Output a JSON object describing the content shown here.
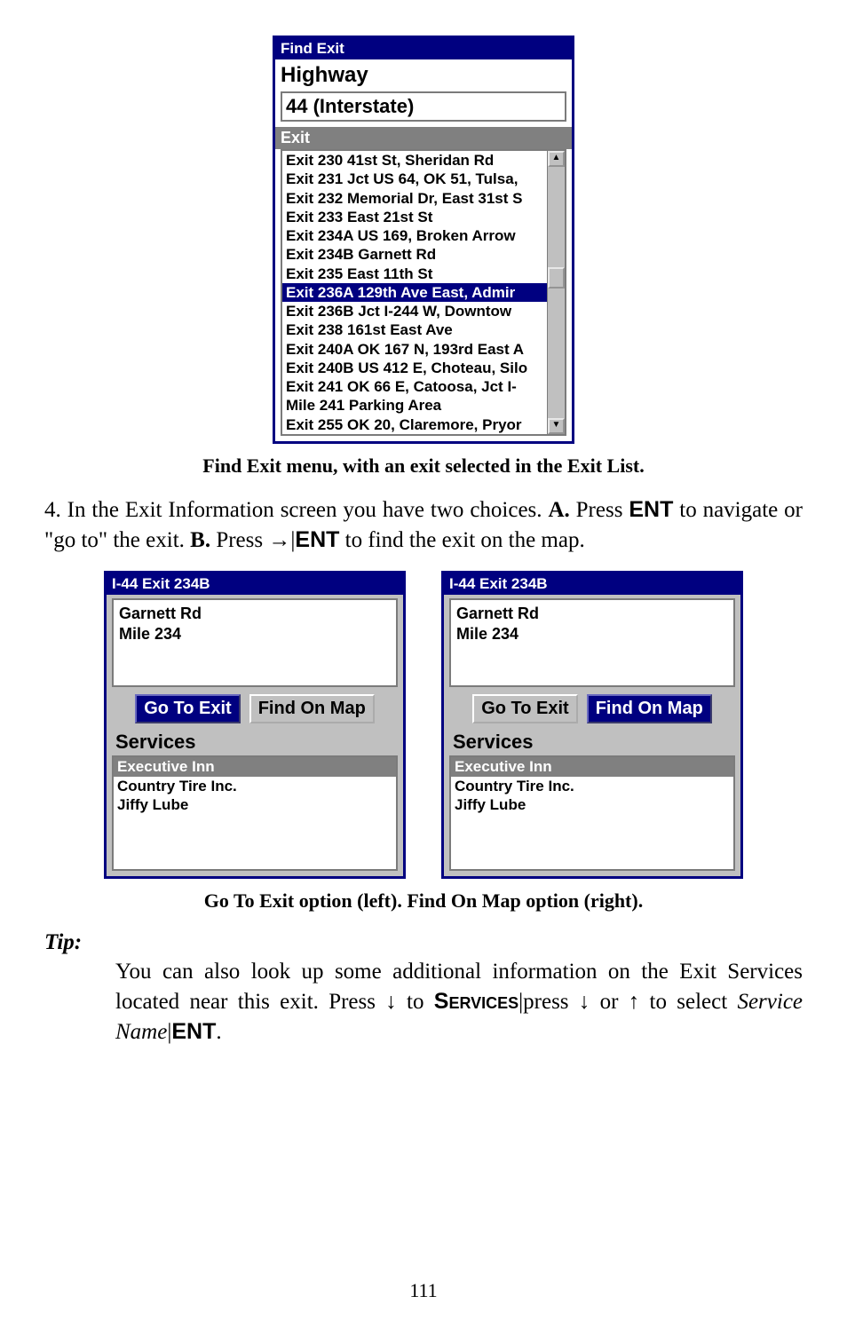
{
  "findExit": {
    "title": "Find Exit",
    "highwayLabel": "Highway",
    "highwayValue": "44 (Interstate)",
    "exitSection": "Exit",
    "exits": [
      "Exit 230 41st St, Sheridan Rd",
      "Exit 231 Jct US 64, OK 51, Tulsa,",
      "Exit 232 Memorial Dr, East 31st S",
      "Exit 233 East 21st St",
      "Exit 234A US 169, Broken Arrow",
      "Exit 234B Garnett Rd",
      "Exit 235 East 11th St",
      "Exit 236A 129th Ave East, Admir",
      "Exit 236B Jct I-244 W, Downtow",
      "Exit 238 161st East Ave",
      "Exit 240A OK 167 N, 193rd East A",
      "Exit 240B US 412 E, Choteau, Silo",
      "Exit 241 OK 66 E, Catoosa, Jct I-",
      "Mile 241 Parking Area",
      "Exit 255 OK 20, Claremore, Pryor"
    ],
    "selectedIndex": 7
  },
  "caption1": "Find Exit menu, with an exit selected in the Exit List.",
  "step4_a": "4. In the Exit Information screen you have two choices. ",
  "step4_boldA": "A.",
  "step4_b": " Press ",
  "step4_key_ent": "ENT",
  "step4_c": " to navigate or \"go to\" the exit. ",
  "step4_boldB": "B.",
  "step4_d": " Press ",
  "step4_arrow_right": "→",
  "step4_pipe": "|",
  "step4_e": " to find the exit on the map.",
  "infoPanel": {
    "title": "I-44 Exit 234B",
    "line1": "Garnett Rd",
    "line2": "Mile 234",
    "goToExit": "Go To Exit",
    "findOnMap": "Find On Map",
    "servicesLabel": "Services",
    "services": [
      "Executive Inn",
      "Country Tire Inc.",
      "Jiffy Lube"
    ],
    "serviceSelectedIndex": 0
  },
  "caption2": "Go To Exit option (left). Find On Map option (right).",
  "tip": {
    "head": "Tip:",
    "bodyA": "You can also look up some additional information on the Exit Services located near this exit. Press ",
    "down": "↓",
    "bodyB": " to ",
    "servicesKey": "Services",
    "bodyC": "|press ",
    "bodyD": " or ",
    "up": "↑",
    "bodyE": " to select ",
    "serviceName": "Service Name",
    "bodyF": "|",
    "entKey": "ENT",
    "bodyG": "."
  },
  "pageNumber": "111"
}
